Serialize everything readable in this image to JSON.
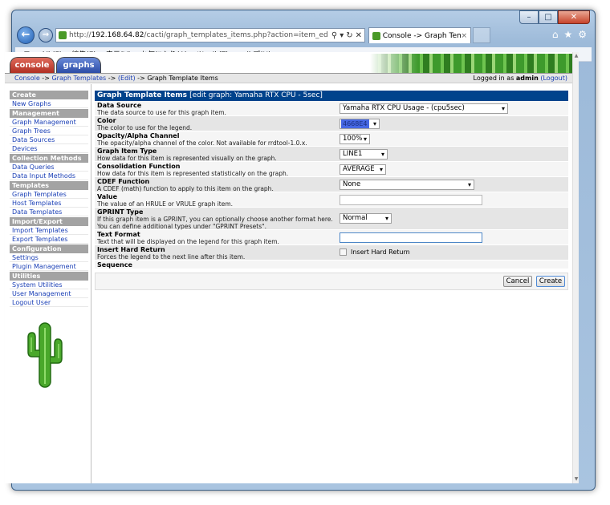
{
  "browser": {
    "url_prefix": "http://",
    "url_host": "192.168.64.82",
    "url_path": "/cacti/graph_templates_items.php?action=item_edit&graph_tem",
    "tab_title": "Console -> Graph Templ...",
    "tab_close": "×",
    "menu": [
      "ファイル(F)",
      "編集(E)",
      "表示(V)",
      "お気に入り(A)",
      "ツール(T)",
      "ヘルプ(H)"
    ]
  },
  "cacti": {
    "tab_console": "console",
    "tab_graphs": "graphs",
    "breadcrumb": {
      "console": "Console",
      "sep1": " -> ",
      "graph_templates": "Graph Templates",
      "sep2": " -> ",
      "edit": "(Edit)",
      "sep3": " -> ",
      "current": "Graph Template Items"
    },
    "login": {
      "prefix": "Logged in as ",
      "user": "admin",
      "logout": "(Logout)"
    }
  },
  "sidebar": [
    {
      "header": "Create",
      "items": [
        "New Graphs"
      ]
    },
    {
      "header": "Management",
      "items": [
        "Graph Management",
        "Graph Trees",
        "Data Sources",
        "Devices"
      ]
    },
    {
      "header": "Collection Methods",
      "items": [
        "Data Queries",
        "Data Input Methods"
      ]
    },
    {
      "header": "Templates",
      "items": [
        "Graph Templates",
        "Host Templates",
        "Data Templates"
      ]
    },
    {
      "header": "Import/Export",
      "items": [
        "Import Templates",
        "Export Templates"
      ]
    },
    {
      "header": "Configuration",
      "items": [
        "Settings",
        "Plugin Management"
      ]
    },
    {
      "header": "Utilities",
      "items": [
        "System Utilities",
        "User Management",
        "Logout User"
      ]
    }
  ],
  "form": {
    "title": "Graph Template Items",
    "subtitle": "[edit graph: Yamaha RTX CPU - 5sec]",
    "fields": {
      "data_source": {
        "label": "Data Source",
        "desc": "The data source to use for this graph item.",
        "value": "Yamaha RTX CPU Usage - (cpu5sec)"
      },
      "color": {
        "label": "Color",
        "desc": "The color to use for the legend.",
        "value": "4668E4",
        "swatch": "#4668e4"
      },
      "opacity": {
        "label": "Opacity/Alpha Channel",
        "desc": "The opacity/alpha channel of the color. Not available for rrdtool-1.0.x.",
        "value": "100%"
      },
      "item_type": {
        "label": "Graph Item Type",
        "desc": "How data for this item is represented visually on the graph.",
        "value": "LINE1"
      },
      "consolidation": {
        "label": "Consolidation Function",
        "desc": "How data for this item is represented statistically on the graph.",
        "value": "AVERAGE"
      },
      "cdef": {
        "label": "CDEF Function",
        "desc": "A CDEF (math) function to apply to this item on the graph.",
        "value": "None"
      },
      "value": {
        "label": "Value",
        "desc": "The value of an HRULE or VRULE graph item.",
        "value": ""
      },
      "gprint": {
        "label": "GPRINT Type",
        "desc1": "If this graph item is a GPRINT, you can optionally choose another format here.",
        "desc2": "You can define additional types under \"GPRINT Presets\".",
        "value": "Normal"
      },
      "text_format": {
        "label": "Text Format",
        "desc": "Text that will be displayed on the legend for this graph item.",
        "value": ""
      },
      "hard_return": {
        "label": "Insert Hard Return",
        "desc": "Forces the legend to the next line after this item.",
        "checkbox_label": "Insert Hard Return",
        "checked": false
      },
      "sequence": {
        "label": "Sequence"
      }
    },
    "buttons": {
      "cancel": "Cancel",
      "create": "Create"
    }
  }
}
